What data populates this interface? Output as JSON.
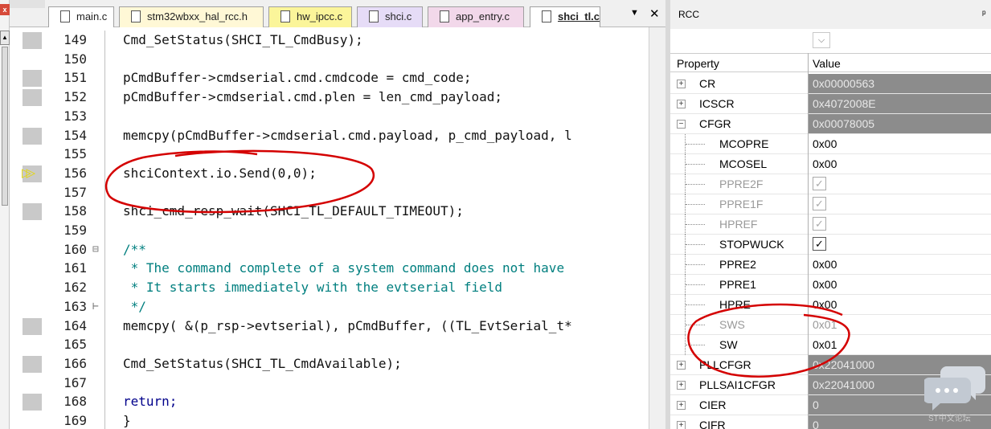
{
  "tabs": [
    {
      "label": "main.c",
      "bg": "#ffffff"
    },
    {
      "label": "stm32wbxx_hal_rcc.h",
      "bg": "#fff8d6"
    },
    {
      "label": "hw_ipcc.c",
      "bg": "#fbf59a"
    },
    {
      "label": "shci.c",
      "bg": "#e6dcf7"
    },
    {
      "label": "app_entry.c",
      "bg": "#f2d8ea"
    },
    {
      "label": "shci_tl.c",
      "bg": "#ffffff",
      "active": true
    }
  ],
  "tab_menu": "▼",
  "tab_close": "✕",
  "code": {
    "line_numbers": [
      "149",
      "150",
      "151",
      "152",
      "153",
      "154",
      "155",
      "156",
      "157",
      "158",
      "159",
      "160",
      "161",
      "162",
      "163",
      "164",
      "165",
      "166",
      "167",
      "168",
      "169"
    ],
    "lines": [
      "Cmd_SetStatus(SHCI_TL_CmdBusy);",
      "",
      "pCmdBuffer->cmdserial.cmd.cmdcode = cmd_code;",
      "pCmdBuffer->cmdserial.cmd.plen = len_cmd_payload;",
      "",
      "memcpy(pCmdBuffer->cmdserial.cmd.payload, p_cmd_payload, l",
      "",
      "shciContext.io.Send(0,0);",
      "",
      "shci_cmd_resp_wait(SHCI_TL_DEFAULT_TIMEOUT);",
      "",
      "/**",
      " * The command complete of a system command does not have",
      " * It starts immediately with the evtserial field",
      " */",
      "memcpy( &(p_rsp->evtserial), pCmdBuffer, ((TL_EvtSerial_t*",
      "",
      "Cmd_SetStatus(SHCI_TL_CmdAvailable);",
      "",
      "return;",
      "}"
    ],
    "fold_markers": {
      "160": "⊟",
      "163": "⊢"
    },
    "current_line": "156"
  },
  "rcc": {
    "title": "RCC",
    "combo_symbol": "⌵",
    "col_property": "Property",
    "col_value": "Value",
    "rows": [
      {
        "name": "CR",
        "value": "0x00000563",
        "type": "group"
      },
      {
        "name": "ICSCR",
        "value": "0x4072008E",
        "type": "group"
      },
      {
        "name": "CFGR",
        "value": "0x00078005",
        "type": "group-open"
      },
      {
        "name": "MCOPRE",
        "value": "0x00",
        "type": "field"
      },
      {
        "name": "MCOSEL",
        "value": "0x00",
        "type": "field"
      },
      {
        "name": "PPRE2F",
        "value": "✓",
        "type": "check-dis"
      },
      {
        "name": "PPRE1F",
        "value": "✓",
        "type": "check-dis"
      },
      {
        "name": "HPREF",
        "value": "✓",
        "type": "check-dis"
      },
      {
        "name": "STOPWUCK",
        "value": "✓",
        "type": "check"
      },
      {
        "name": "PPRE2",
        "value": "0x00",
        "type": "field"
      },
      {
        "name": "PPRE1",
        "value": "0x00",
        "type": "field"
      },
      {
        "name": "HPRE",
        "value": "0x00",
        "type": "field"
      },
      {
        "name": "SWS",
        "value": "0x01",
        "type": "field-dim"
      },
      {
        "name": "SW",
        "value": "0x01",
        "type": "field"
      },
      {
        "name": "PLLCFGR",
        "value": "0x22041000",
        "type": "group"
      },
      {
        "name": "PLLSAI1CFGR",
        "value": "0x22041000",
        "type": "group"
      },
      {
        "name": "CIER",
        "value": "0",
        "type": "group"
      },
      {
        "name": "CIFR",
        "value": "0",
        "type": "group"
      }
    ]
  },
  "watermark": "ST中文论坛",
  "colors": {
    "annotation": "#d40000",
    "group_value_bg": "#8c8c8c",
    "keyword": "#00008b",
    "comment": "#007f7f"
  }
}
